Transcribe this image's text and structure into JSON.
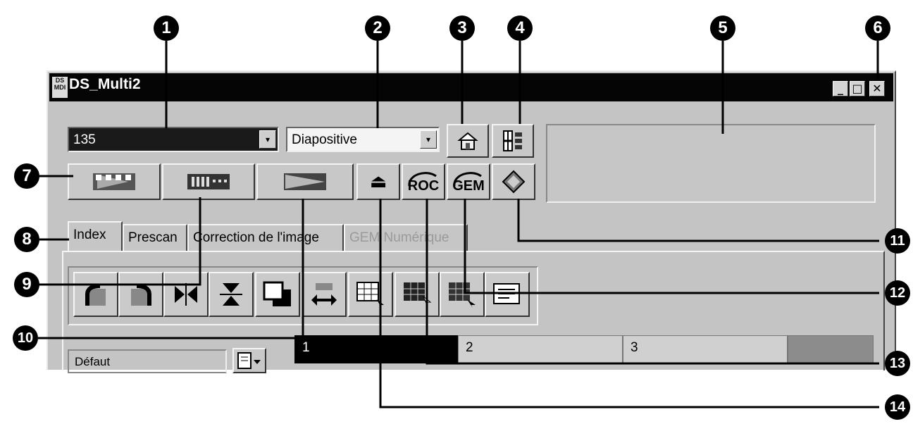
{
  "window": {
    "title": "DS_Multi2",
    "icon_text": "DS\nMDI",
    "minimize_glyph": "_",
    "maximize_glyph": "□",
    "close_glyph": "✕"
  },
  "controls": {
    "film_format": {
      "value": "135"
    },
    "film_type": {
      "value": "Diapositive"
    },
    "dropdown_arrow": "▾"
  },
  "toolbar": {
    "eject_glyph": "⏏",
    "roc_label": "ROC",
    "gem_label": "GEM"
  },
  "tabs": [
    {
      "label": "Index",
      "active": true,
      "enabled": true
    },
    {
      "label": "Prescan",
      "active": false,
      "enabled": true
    },
    {
      "label": "Correction de l'image",
      "active": false,
      "enabled": true
    },
    {
      "label": "GEM Numérique",
      "active": false,
      "enabled": false
    }
  ],
  "settings": {
    "value": "Défaut"
  },
  "strip": {
    "frames": [
      "1",
      "2",
      "3"
    ]
  },
  "callouts": [
    "1",
    "2",
    "3",
    "4",
    "5",
    "6",
    "7",
    "8",
    "9",
    "10",
    "11",
    "12",
    "13",
    "14"
  ],
  "colors": {
    "titlebar": "#050505",
    "face": "#c4c4c4",
    "callout": "#000000"
  }
}
